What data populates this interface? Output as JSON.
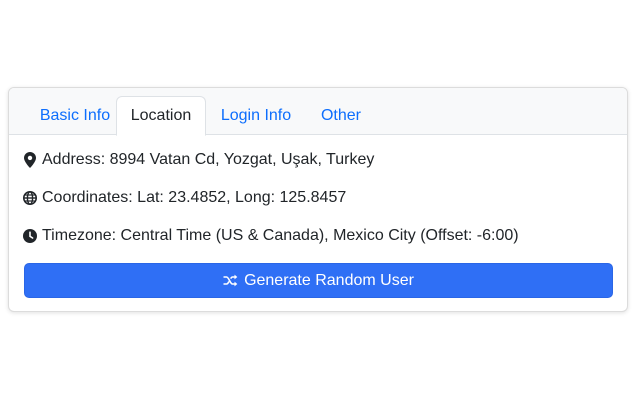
{
  "tabs": [
    {
      "label": "Basic Info",
      "active": false
    },
    {
      "label": "Location",
      "active": true
    },
    {
      "label": "Login Info",
      "active": false
    },
    {
      "label": "Other",
      "active": false
    }
  ],
  "location": {
    "address": "Address: 8994 Vatan Cd, Yozgat, Uşak, Turkey",
    "coordinates": "Coordinates: Lat: 23.4852, Long: 125.8457",
    "timezone": "Timezone: Central Time (US & Canada), Mexico City (Offset: -6:00)"
  },
  "icons": {
    "address": "map-marker-icon",
    "coordinates": "globe-icon",
    "timezone": "clock-icon",
    "generate": "shuffle-icon"
  },
  "actions": {
    "generate_label": "Generate Random User"
  },
  "colors": {
    "primary": "#2f6ff5",
    "tab_link": "#0d6efd",
    "text": "#212529"
  }
}
